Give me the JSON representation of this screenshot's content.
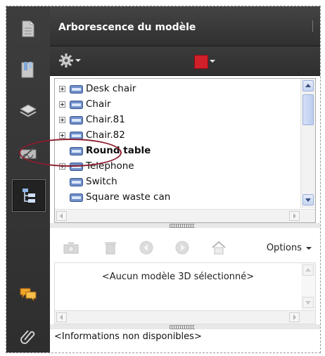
{
  "header": {
    "title": "Arborescence du modèle"
  },
  "colors": {
    "swatch": "#d0202a",
    "highlight_ellipse": "#8b1d2e",
    "nav_bg": "#3a3a3a"
  },
  "nav": {
    "items": [
      {
        "icon": "page-icon"
      },
      {
        "icon": "bookmarks-icon"
      },
      {
        "icon": "layers-icon"
      },
      {
        "icon": "signatures-icon"
      },
      {
        "icon": "model-tree-icon",
        "active": true
      },
      {
        "icon": "comments-icon"
      },
      {
        "icon": "attachment-icon"
      }
    ]
  },
  "tree": {
    "items": [
      {
        "label": "Desk chair",
        "expandable": true
      },
      {
        "label": "Chair",
        "expandable": true
      },
      {
        "label": "Chair.81",
        "expandable": true
      },
      {
        "label": "Chair.82",
        "expandable": true
      },
      {
        "label": "Round table",
        "expandable": false,
        "selected": true
      },
      {
        "label": "Telephone",
        "expandable": true
      },
      {
        "label": "Switch",
        "expandable": false
      },
      {
        "label": "Square waste can",
        "expandable": false
      }
    ]
  },
  "toolbar3d": {
    "options_label": "Options"
  },
  "model_info": {
    "text": "<Aucun modèle 3D sélectionné>"
  },
  "info": {
    "text": "<Informations non disponibles>"
  }
}
